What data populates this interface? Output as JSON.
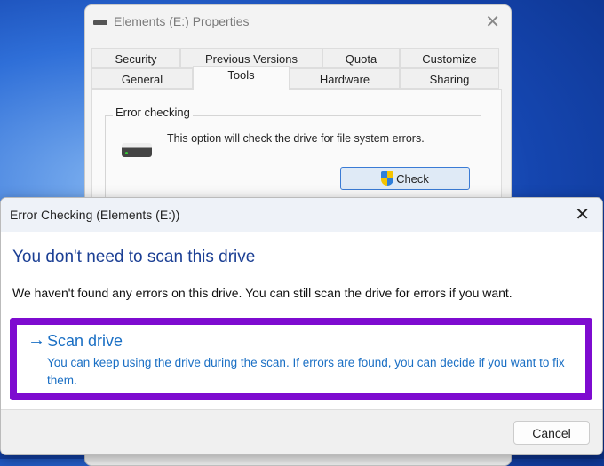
{
  "properties": {
    "title": "Elements (E:) Properties",
    "tabs_row1": [
      "Security",
      "Previous Versions",
      "Quota",
      "Customize"
    ],
    "tabs_row2": [
      "General",
      "Tools",
      "Hardware",
      "Sharing"
    ],
    "group_label": "Error checking",
    "description": "This option will check the drive for file system errors.",
    "check_label": "Check"
  },
  "dialog": {
    "title": "Error Checking (Elements (E:))",
    "heading": "You don't need to scan this drive",
    "message": "We haven't found any errors on this drive. You can still scan the drive for errors if you want.",
    "option_title": "Scan drive",
    "option_desc": "You can keep using the drive during the scan. If errors are found, you can decide if you want to fix them.",
    "cancel_label": "Cancel",
    "highlight_color": "#7e0bd0"
  }
}
